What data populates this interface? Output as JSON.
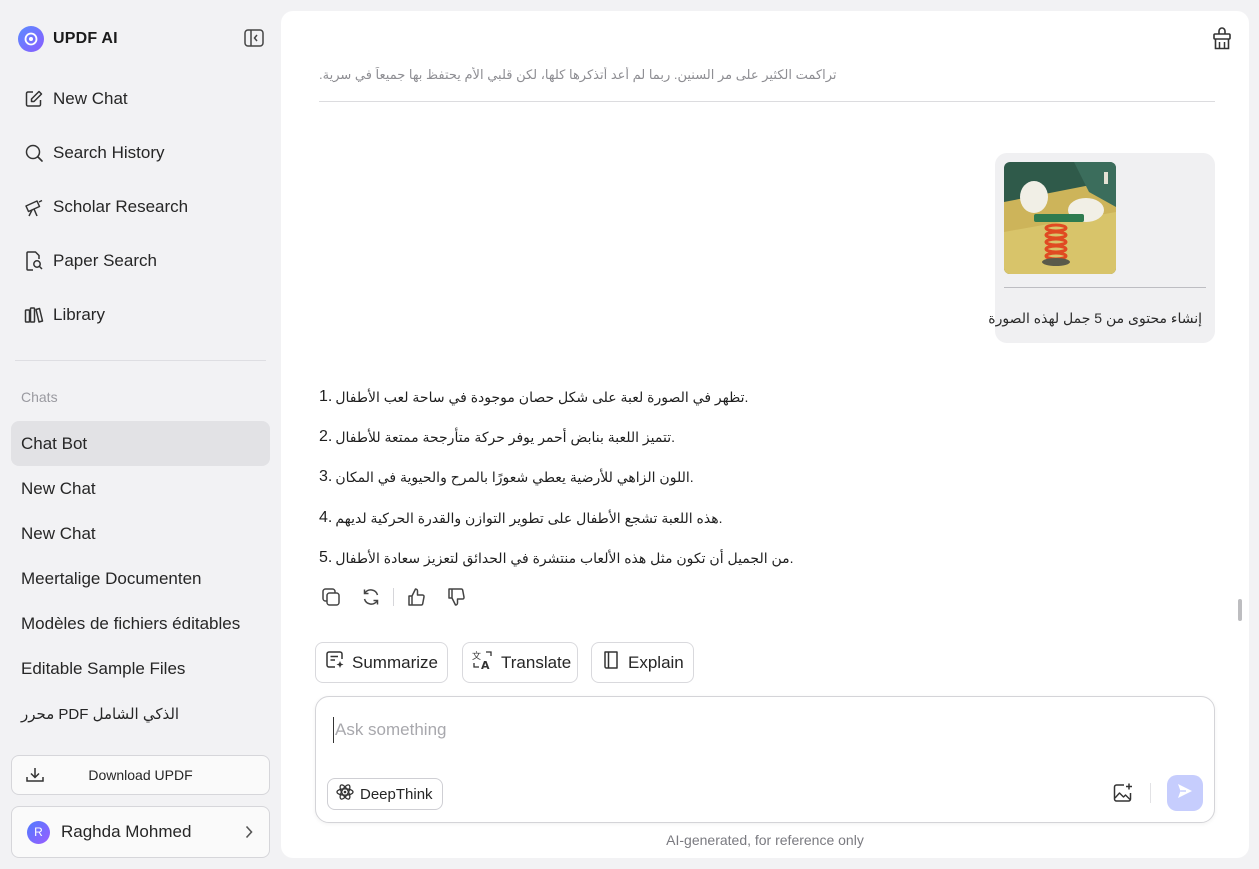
{
  "brand": {
    "name": "UPDF AI"
  },
  "nav": [
    {
      "label": "New Chat",
      "icon": "edit-icon"
    },
    {
      "label": "Search History",
      "icon": "search-icon"
    },
    {
      "label": "Scholar Research",
      "icon": "telescope-icon"
    },
    {
      "label": "Paper Search",
      "icon": "document-search-icon"
    },
    {
      "label": "Library",
      "icon": "library-icon"
    }
  ],
  "chats": {
    "title": "Chats",
    "items": [
      {
        "label": "Chat Bot",
        "active": true
      },
      {
        "label": "New Chat"
      },
      {
        "label": "New Chat"
      },
      {
        "label": "Meertalige Documenten"
      },
      {
        "label": "Modèles de fichiers éditables"
      },
      {
        "label": "Editable Sample Files"
      },
      {
        "label": "محرر PDF الذكي الشامل"
      }
    ]
  },
  "download": {
    "label": "Download UPDF"
  },
  "user": {
    "initial": "R",
    "name": "Raghda Mohmed"
  },
  "conversation": {
    "previous_text": "تراكمت الكثير على مر السنين. ربما لم أعد أتذكرها كلها، لكن قلبي الأم يحتفظ بها جميعاً في سرية.",
    "user_message": {
      "text": "إنشاء محتوى من 5 جمل لهذه الصورة"
    },
    "answer": [
      {
        "num": "1.",
        "text": "تظهر في الصورة لعبة على شكل حصان موجودة في ساحة لعب الأطفال."
      },
      {
        "num": "2.",
        "text": "تتميز اللعبة بنابض أحمر يوفر حركة متأرجحة ممتعة للأطفال."
      },
      {
        "num": "3.",
        "text": "اللون الزاهي للأرضية يعطي شعورًا بالمرح والحيوية في المكان."
      },
      {
        "num": "4.",
        "text": "هذه اللعبة تشجع الأطفال على تطوير التوازن والقدرة الحركية لديهم."
      },
      {
        "num": "5.",
        "text": "من الجميل أن تكون مثل هذه الألعاب منتشرة في الحدائق لتعزيز سعادة الأطفال."
      }
    ]
  },
  "quick_actions": [
    {
      "label": "Summarize",
      "icon": "summarize-icon"
    },
    {
      "label": "Translate",
      "icon": "translate-icon"
    },
    {
      "label": "Explain",
      "icon": "book-icon"
    }
  ],
  "composer": {
    "placeholder": "Ask something",
    "value": "",
    "deepthink_label": "DeepThink"
  },
  "disclaimer": "AI-generated, for reference only",
  "colors": {
    "accent": "#c6cdfd",
    "brand_gradient_start": "#5b8cff",
    "brand_gradient_end": "#8a5cff",
    "active_chat_bg": "#e2e2e5"
  }
}
